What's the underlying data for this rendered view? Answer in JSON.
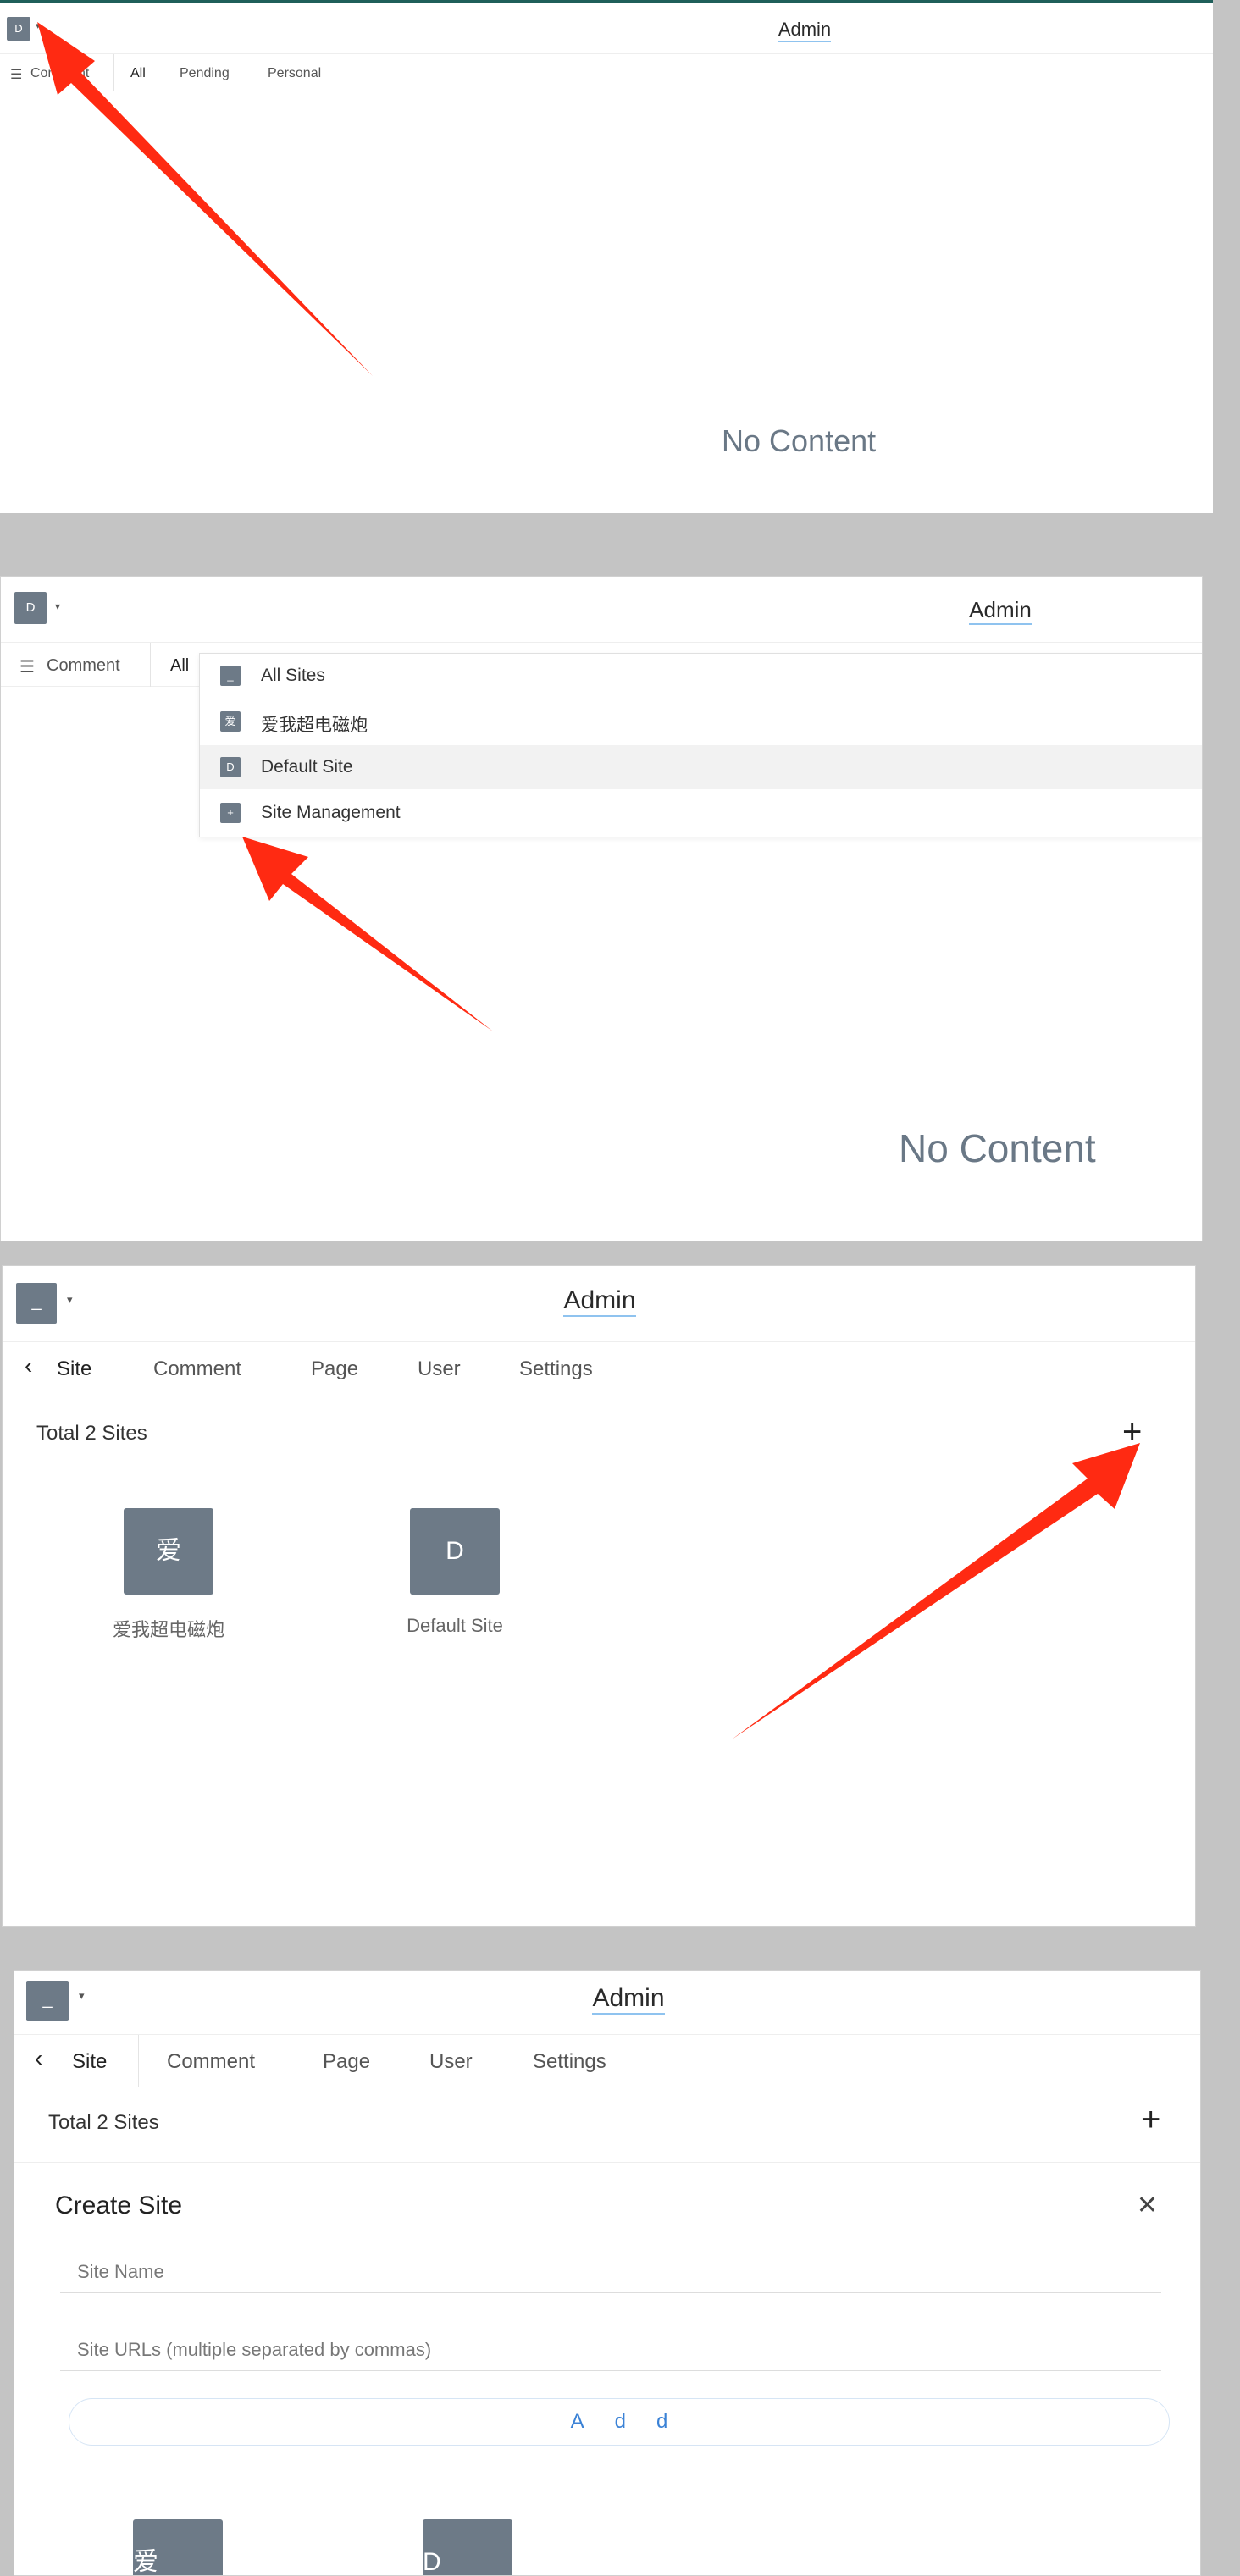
{
  "admin_title": "Admin",
  "no_content": "No Content",
  "panel1": {
    "site_initial": "D",
    "caret": "▾",
    "tabs": [
      "Comment",
      "All",
      "Pending",
      "Personal"
    ],
    "menu_icon": "☰"
  },
  "panel2": {
    "site_initial": "D",
    "caret": "▾",
    "tabs": [
      "Comment",
      "All"
    ],
    "menu_icon": "☰",
    "dropdown": [
      {
        "icon": "_",
        "label": "All Sites"
      },
      {
        "icon": "爱",
        "label": "爱我超电磁炮"
      },
      {
        "icon": "D",
        "label": "Default Site"
      },
      {
        "icon": "+",
        "label": "Site Management"
      }
    ]
  },
  "panel3": {
    "site_initial": "_",
    "caret": "▾",
    "back_icon": "‹",
    "tabs": [
      "Site",
      "Comment",
      "Page",
      "User",
      "Settings"
    ],
    "site_count": "Total 2 Sites",
    "add_icon": "+",
    "sites": [
      {
        "initial": "爱",
        "name": "爱我超电磁炮"
      },
      {
        "initial": "D",
        "name": "Default Site"
      }
    ]
  },
  "panel4": {
    "site_initial": "_",
    "caret": "▾",
    "back_icon": "‹",
    "tabs": [
      "Site",
      "Comment",
      "Page",
      "User",
      "Settings"
    ],
    "site_count": "Total 2 Sites",
    "add_icon": "+",
    "create_title": "Create Site",
    "close_icon": "✕",
    "name_placeholder": "Site Name",
    "urls_placeholder": "Site URLs (multiple separated by commas)",
    "add_label": "Add",
    "tiles": [
      "爱",
      "D"
    ]
  },
  "colors": {
    "accent_bar": "#1f5f5a",
    "site_tile": "#6d7a87",
    "arrow": "#ff2a12",
    "link_blue": "#3b82d6"
  }
}
